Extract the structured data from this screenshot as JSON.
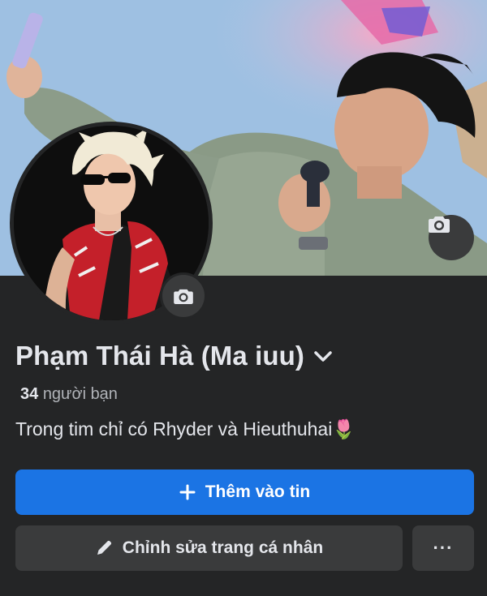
{
  "profile": {
    "name": "Phạm Thái Hà (Ma iuu)",
    "friends_count": "34",
    "friends_label": "người bạn",
    "bio": "Trong tim chỉ có Rhyder và Hieuthuhai🌷"
  },
  "actions": {
    "add_story_label": "Thêm vào tin",
    "edit_profile_label": "Chỉnh sửa trang cá nhân",
    "more_label": "···"
  },
  "icons": {
    "cover_camera": "camera-icon",
    "avatar_camera": "camera-icon",
    "name_dropdown": "chevron-down-icon",
    "add_story": "plus-icon",
    "edit_profile": "pencil-icon"
  },
  "colors": {
    "background": "#242526",
    "primary_button": "#1b74e4",
    "secondary_button": "#3a3b3c",
    "text_primary": "#e4e6eb",
    "text_secondary": "#b0b3b8"
  }
}
